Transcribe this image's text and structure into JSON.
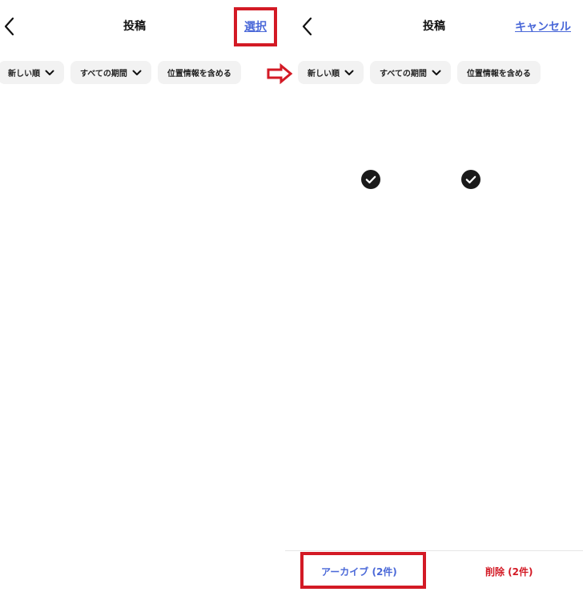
{
  "colors": {
    "accent_link": "#4a68d8",
    "highlight_red": "#d31a25",
    "delete_red": "#d31a25",
    "chip_bg": "#f2f2f2",
    "check_circle": "#1a1a1a"
  },
  "icons": [
    "back-chevron-icon",
    "chevron-down-icon",
    "check-circle-icon",
    "right-arrow-icon"
  ],
  "left_panel": {
    "title": "投稿",
    "action_label": "選択",
    "filters": [
      "新しい順",
      "すべての期間",
      "位置情報を含める"
    ]
  },
  "right_panel": {
    "title": "投稿",
    "action_label": "キャンセル",
    "filters": [
      "新しい順",
      "すべての期間",
      "位置情報を含める"
    ],
    "selected_count": 2,
    "archive_label": "アーカイブ (2件)",
    "delete_label": "削除 (2件)"
  }
}
